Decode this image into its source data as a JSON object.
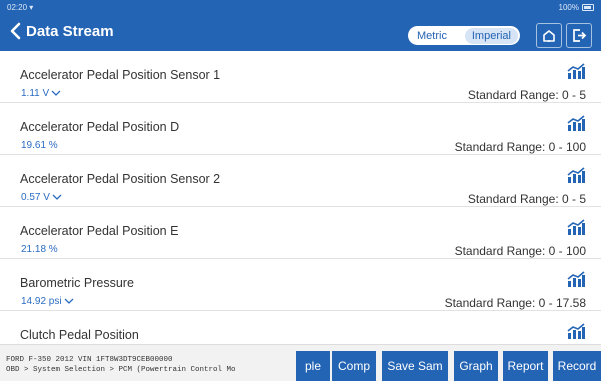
{
  "status": {
    "time": "02:20",
    "battery": "100%"
  },
  "header": {
    "title": "Data Stream",
    "unit_metric": "Metric",
    "unit_imperial": "Imperial",
    "selected_unit": "Imperial"
  },
  "rows": [
    {
      "name": "Accelerator Pedal Position Sensor 1",
      "value": "1.11 V",
      "range": "Standard Range: 0 - 5",
      "has_dropdown": true
    },
    {
      "name": "Accelerator Pedal Position D",
      "value": "19.61 %",
      "range": "Standard Range: 0 - 100",
      "has_dropdown": false
    },
    {
      "name": "Accelerator Pedal Position Sensor 2",
      "value": "0.57 V",
      "range": "Standard Range: 0 - 5",
      "has_dropdown": true
    },
    {
      "name": "Accelerator Pedal Position E",
      "value": "21.18 %",
      "range": "Standard Range: 0 - 100",
      "has_dropdown": false
    },
    {
      "name": "Barometric Pressure",
      "value": "14.92 psi",
      "range": "Standard Range: 0 - 17.58",
      "has_dropdown": true
    },
    {
      "name": "Clutch Pedal Position",
      "value": "",
      "range": "",
      "has_dropdown": false
    }
  ],
  "footer": {
    "vehicle_info": "FORD  F-350  2012  VIN  1FT8W3DT9CEB00000",
    "path": "OBD > System Selection > PCM (Powertrain Control Mo",
    "buttons": [
      "ple",
      "Comp",
      "Save Sam",
      "Graph",
      "Report",
      "Record"
    ]
  },
  "colors": {
    "header_bg": "#2364b4",
    "value_text": "#2a6cc0",
    "button_bg": "#2364b4"
  },
  "icons": {
    "back": "chevron-left-icon",
    "home": "home-icon",
    "exit": "exit-icon",
    "graph": "bar-chart-icon"
  }
}
